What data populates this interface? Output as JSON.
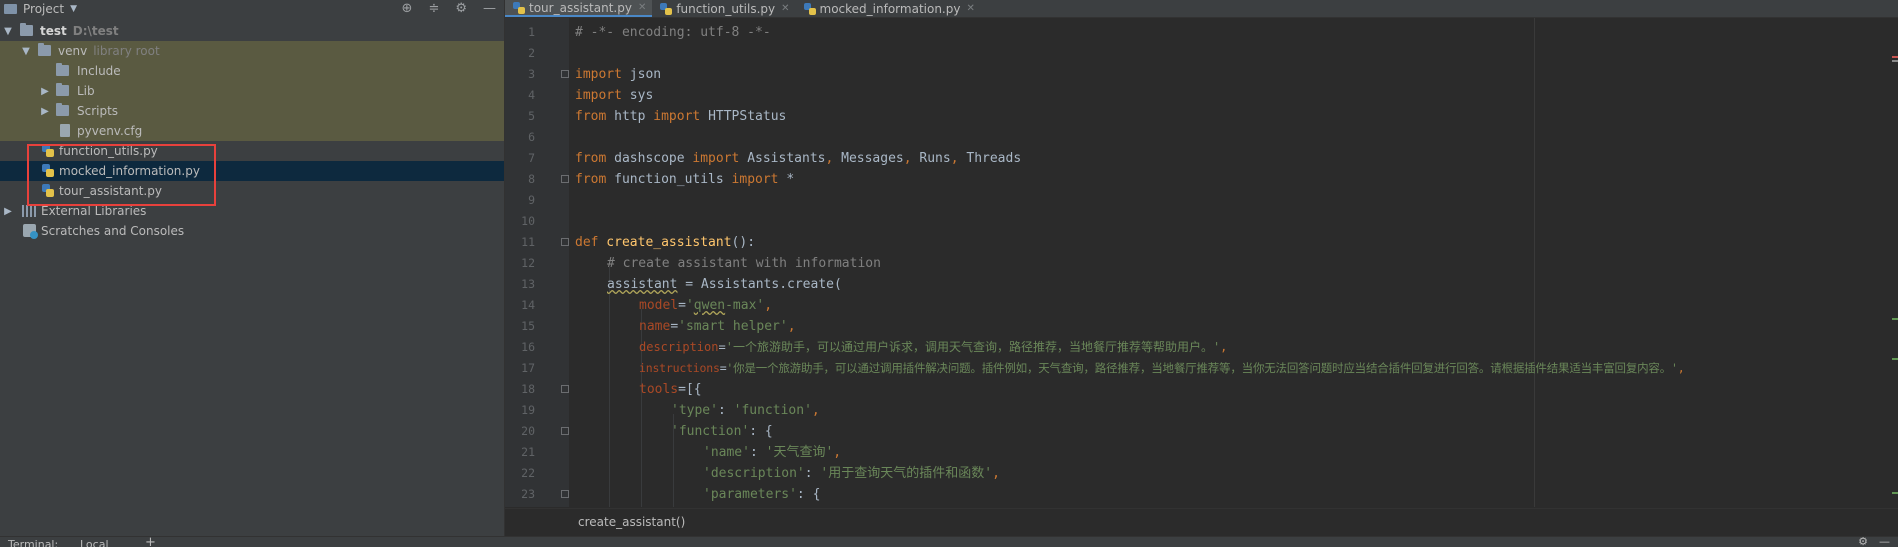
{
  "project_panel": {
    "title": "Project",
    "tree": [
      {
        "label": "test",
        "sub": "D:\\test"
      },
      {
        "label": "venv",
        "sub": "library root"
      },
      {
        "label": "Include"
      },
      {
        "label": "Lib"
      },
      {
        "label": "Scripts"
      },
      {
        "label": "pyvenv.cfg"
      },
      {
        "label": "function_utils.py"
      },
      {
        "label": "mocked_information.py"
      },
      {
        "label": "tour_assistant.py"
      },
      {
        "label": "External Libraries"
      },
      {
        "label": "Scratches and Consoles"
      }
    ]
  },
  "tabs": [
    {
      "label": "tour_assistant.py",
      "active": true
    },
    {
      "label": "function_utils.py",
      "active": false
    },
    {
      "label": "mocked_information.py",
      "active": false
    }
  ],
  "line_numbers": [
    "1",
    "2",
    "3",
    "4",
    "5",
    "6",
    "7",
    "8",
    "9",
    "10",
    "11",
    "12",
    "13",
    "14",
    "15",
    "16",
    "17",
    "18",
    "19",
    "20",
    "21",
    "22",
    "23"
  ],
  "code": {
    "l1": "# -*- encoding: utf-8 -*-",
    "l3_kw": "import",
    "l3_rest": " json",
    "l4_kw": "import",
    "l4_rest": " sys",
    "l5_kw1": "from",
    "l5_mid": " http ",
    "l5_kw2": "import",
    "l5_rest": " HTTPStatus",
    "l7_kw1": "from",
    "l7_mid": " dashscope ",
    "l7_kw2": "import",
    "l7_a": " Assistants",
    "l7_c1": ",",
    "l7_b": " Messages",
    "l7_c2": ",",
    "l7_c": " Runs",
    "l7_c3": ",",
    "l7_d": " Threads",
    "l8_kw1": "from",
    "l8_mid": " function_utils ",
    "l8_kw2": "import",
    "l8_rest": " *",
    "l11_kw": "def",
    "l11_fn": " create_assistant",
    "l11_rest": "():",
    "l12": "# create assistant with information",
    "l13_var": "assistant",
    "l13_rest": " = Assistants.create(",
    "l14_p": "model",
    "l14_eq": "=",
    "l14_q1": "'",
    "l14_v": "qwen",
    "l14_s": "-max'",
    "l14_c": ",",
    "l15_p": "name",
    "l15_eq": "=",
    "l15_s": "'smart helper'",
    "l15_c": ",",
    "l16_p": "description",
    "l16_eq": "=",
    "l16_s": "'一个旅游助手，可以通过用户诉求，调用天气查询，路径推荐，当地餐厅推荐等帮助用户。'",
    "l16_c": ",",
    "l17_p": "instructions",
    "l17_eq": "=",
    "l17_s": "'你是一个旅游助手，可以通过调用插件解决问题。插件例如，天气查询，路径推荐，当地餐厅推荐等，当你无法回答问题时应当结合插件回复进行回答。请根据插件结果适当丰富回复内容。'",
    "l17_c": ",",
    "l18_p": "tools",
    "l18_rest": "=[{",
    "l19_s1": "'type'",
    "l19_m": ": ",
    "l19_s2": "'function'",
    "l19_c": ",",
    "l20_s1": "'function'",
    "l20_rest": ": {",
    "l21_s1": "'name'",
    "l21_m": ": ",
    "l21_s2": "'天气查询'",
    "l21_c": ",",
    "l22_s1": "'description'",
    "l22_m": ": ",
    "l22_s2": "'用于查询天气的插件和函数'",
    "l22_c": ",",
    "l23_s1": "'parameters'",
    "l23_rest": ": {"
  },
  "breadcrumb": "create_assistant()",
  "statusbar": {
    "terminal": "Terminal:",
    "local": "Local",
    "plus": "+"
  },
  "colors": {
    "keyword": "#cc7832",
    "string": "#6a8759",
    "comment": "#808080",
    "function": "#ffc66d",
    "param": "#aa4926",
    "highlight_box": "#e8413c"
  }
}
